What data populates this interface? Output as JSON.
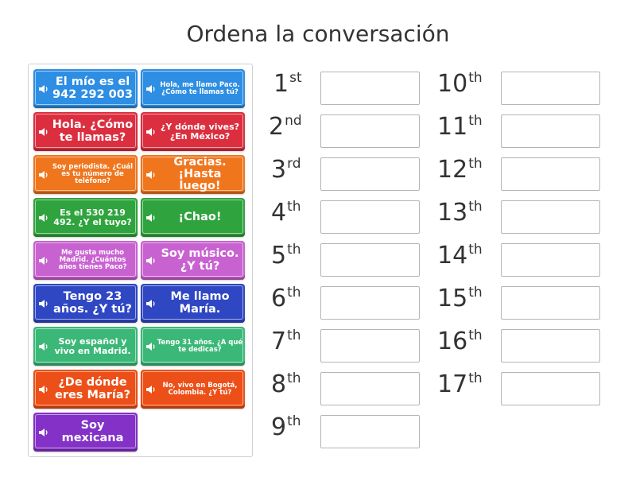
{
  "title": "Ordena la conversación",
  "cards": [
    {
      "text": "El mío es el 942 292 003",
      "color": "#2e8ee3",
      "icon": "speaker-icon"
    },
    {
      "text": "Hola, me llamo Paco. ¿Cómo te llamas tú?",
      "color": "#2e8ee3",
      "icon": "speaker-icon"
    },
    {
      "text": "Hola. ¿Cómo te llamas?",
      "color": "#db2f40",
      "icon": "speaker-icon"
    },
    {
      "text": "¿Y dónde vives? ¿En México?",
      "color": "#db2f40",
      "icon": "speaker-icon"
    },
    {
      "text": "Soy periodista. ¿Cuál es tu número de teléfono?",
      "color": "#f0761e",
      "icon": "speaker-icon"
    },
    {
      "text": "Gracias. ¡Hasta luego!",
      "color": "#f0761e",
      "icon": "speaker-icon"
    },
    {
      "text": "Es el 530 219 492. ¿Y el tuyo?",
      "color": "#2fa33d",
      "icon": "speaker-icon"
    },
    {
      "text": "¡Chao!",
      "color": "#2fa33d",
      "icon": "speaker-icon"
    },
    {
      "text": "Me gusta mucho Madrid. ¿Cuántos años tienes Paco?",
      "color": "#c962d1",
      "icon": "speaker-icon"
    },
    {
      "text": "Soy músico. ¿Y tú?",
      "color": "#c962d1",
      "icon": "speaker-icon"
    },
    {
      "text": "Tengo 23 años. ¿Y tú?",
      "color": "#2f47c3",
      "icon": "speaker-icon"
    },
    {
      "text": "Me llamo María.",
      "color": "#2f47c3",
      "icon": "speaker-icon"
    },
    {
      "text": "Soy español y vivo en Madrid.",
      "color": "#3bb877",
      "icon": "speaker-icon"
    },
    {
      "text": "Tengo 31 años. ¿A qué te dedicas?",
      "color": "#3bb877",
      "icon": "speaker-icon"
    },
    {
      "text": "¿De dónde eres María?",
      "color": "#ec4f17",
      "icon": "speaker-icon"
    },
    {
      "text": "No, vivo en Bogotá, Colombia. ¿Y tú?",
      "color": "#ec4f17",
      "icon": "speaker-icon"
    },
    {
      "text": "Soy mexicana",
      "color": "#8331c6",
      "icon": "speaker-icon"
    }
  ],
  "slots": [
    {
      "num": "1",
      "suffix": "st",
      "value": ""
    },
    {
      "num": "2",
      "suffix": "nd",
      "value": ""
    },
    {
      "num": "3",
      "suffix": "rd",
      "value": ""
    },
    {
      "num": "4",
      "suffix": "th",
      "value": ""
    },
    {
      "num": "5",
      "suffix": "th",
      "value": ""
    },
    {
      "num": "6",
      "suffix": "th",
      "value": ""
    },
    {
      "num": "7",
      "suffix": "th",
      "value": ""
    },
    {
      "num": "8",
      "suffix": "th",
      "value": ""
    },
    {
      "num": "9",
      "suffix": "th",
      "value": ""
    },
    {
      "num": "10",
      "suffix": "th",
      "value": ""
    },
    {
      "num": "11",
      "suffix": "th",
      "value": ""
    },
    {
      "num": "12",
      "suffix": "th",
      "value": ""
    },
    {
      "num": "13",
      "suffix": "th",
      "value": ""
    },
    {
      "num": "14",
      "suffix": "th",
      "value": ""
    },
    {
      "num": "15",
      "suffix": "th",
      "value": ""
    },
    {
      "num": "16",
      "suffix": "th",
      "value": ""
    },
    {
      "num": "17",
      "suffix": "th",
      "value": ""
    }
  ]
}
